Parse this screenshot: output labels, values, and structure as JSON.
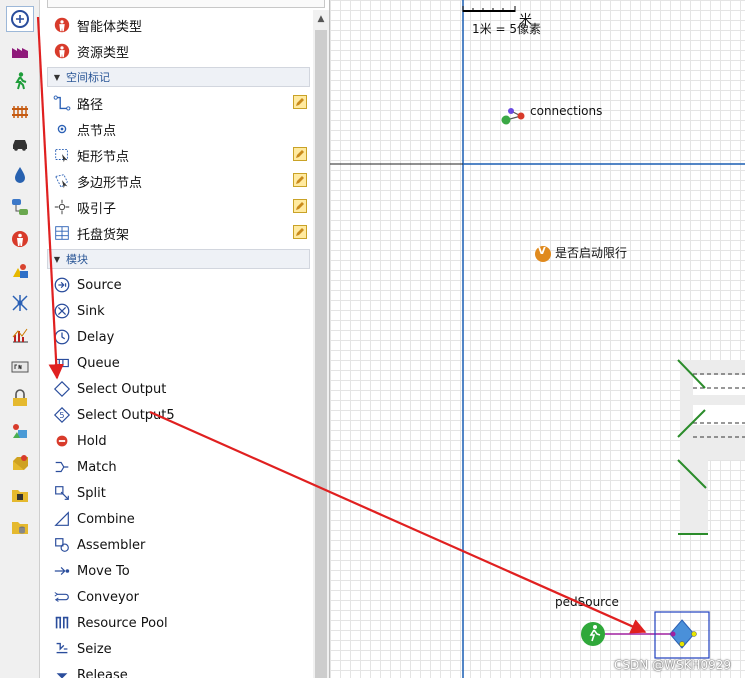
{
  "palette": {
    "top_items": [
      {
        "label": "智能体类型",
        "icon": "agent-type-icon"
      },
      {
        "label": "资源类型",
        "icon": "resource-type-icon"
      }
    ],
    "space_section": {
      "title": "空间标记",
      "items": [
        {
          "label": "路径",
          "icon": "path-icon",
          "editable": true
        },
        {
          "label": "点节点",
          "icon": "point-node-icon",
          "editable": false
        },
        {
          "label": "矩形节点",
          "icon": "rect-node-icon",
          "editable": true
        },
        {
          "label": "多边形节点",
          "icon": "polygon-node-icon",
          "editable": true
        },
        {
          "label": "吸引子",
          "icon": "attractor-icon",
          "editable": true
        },
        {
          "label": "托盘货架",
          "icon": "pallet-rack-icon",
          "editable": true
        }
      ]
    },
    "blocks_section": {
      "title": "模块",
      "items": [
        {
          "label": "Source",
          "icon": "source-icon"
        },
        {
          "label": "Sink",
          "icon": "sink-icon"
        },
        {
          "label": "Delay",
          "icon": "delay-icon"
        },
        {
          "label": "Queue",
          "icon": "queue-icon"
        },
        {
          "label": "Select Output",
          "icon": "select-output-icon"
        },
        {
          "label": "Select Output5",
          "icon": "select-output5-icon"
        },
        {
          "label": "Hold",
          "icon": "hold-icon"
        },
        {
          "label": "Match",
          "icon": "match-icon"
        },
        {
          "label": "Split",
          "icon": "split-icon"
        },
        {
          "label": "Combine",
          "icon": "combine-icon"
        },
        {
          "label": "Assembler",
          "icon": "assembler-icon"
        },
        {
          "label": "Move To",
          "icon": "move-to-icon"
        },
        {
          "label": "Conveyor",
          "icon": "conveyor-icon"
        },
        {
          "label": "Resource Pool",
          "icon": "resource-pool-icon"
        },
        {
          "label": "Seize",
          "icon": "seize-icon"
        },
        {
          "label": "Release",
          "icon": "release-icon"
        }
      ]
    }
  },
  "rail": [
    "process-library-icon",
    "factory-icon",
    "pedestrian-icon",
    "rail-icon",
    "car-icon",
    "fluid-icon",
    "statechart-icon",
    "agent-icon",
    "presentation-icon",
    "network-icon",
    "analysis-icon",
    "controls-icon",
    "connectivity-icon",
    "pictures-icon",
    "3d-objects-icon",
    "folder-icon",
    "database-icon"
  ],
  "canvas": {
    "scale_unit": "米",
    "scale_text": "1米 = 5像素",
    "connections_label": "connections",
    "variable_badge": "V",
    "variable_label": "是否启动限行",
    "ped_source_label": "pedSource"
  },
  "watermark": "CSDN @WSKH0929",
  "colors": {
    "arrow": "#e02020",
    "section_title": "#2b5797",
    "axis": "#1a5fb4"
  }
}
